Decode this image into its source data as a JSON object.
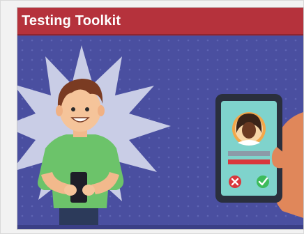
{
  "card": {
    "title": "Testing Toolkit"
  },
  "colors": {
    "title_bar": "#b5323c",
    "background": "#4a4fa0",
    "burst": "#c9cde6",
    "shirt": "#6cc36a",
    "phone_screen": "#7fd3cc",
    "reject": "#d9373c",
    "accept": "#3dbb5b"
  },
  "icons": {
    "reject": "close-icon",
    "accept": "check-icon"
  }
}
